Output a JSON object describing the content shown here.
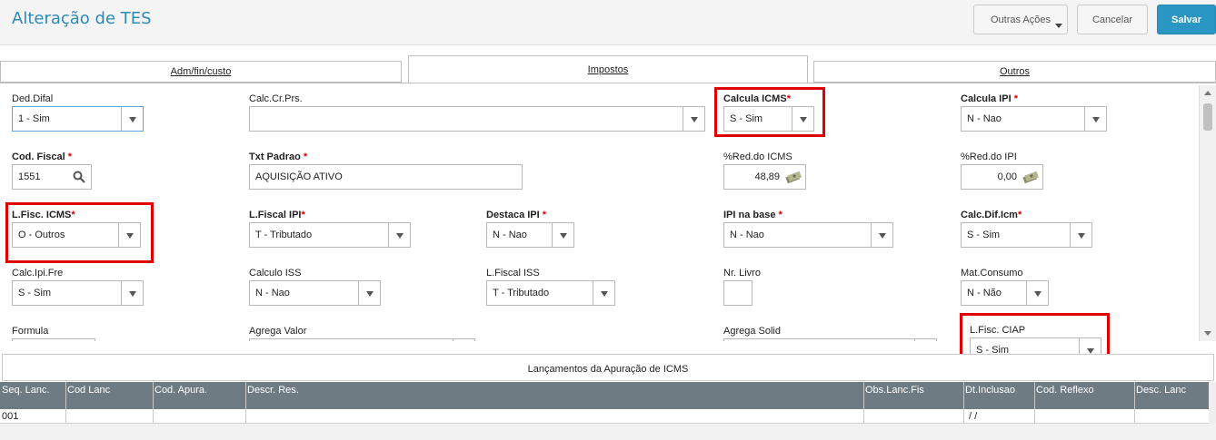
{
  "header": {
    "title": "Alteração de TES",
    "more_actions": "Outras Ações",
    "cancel": "Cancelar",
    "save": "Salvar"
  },
  "tabs": [
    {
      "label": "Adm/fin/custo",
      "active": false
    },
    {
      "label": "Impostos",
      "active": true
    },
    {
      "label": "Outros",
      "active": false
    }
  ],
  "form": {
    "ded_difal": {
      "label": "Ded.Difal",
      "value": "1 - Sim"
    },
    "calc_cr_prs": {
      "label": "Calc.Cr.Prs.",
      "value": ""
    },
    "calcula_icms": {
      "label": "Calcula ICMS",
      "value": "S - Sim",
      "required": "*"
    },
    "calcula_ipi": {
      "label": "Calcula IPI",
      "value": "N - Nao",
      "required": "*"
    },
    "cod_fiscal": {
      "label": "Cod. Fiscal",
      "value": "1551",
      "required": "*"
    },
    "txt_padrao": {
      "label": "Txt Padrao",
      "value": "AQUISIÇÃO ATIVO",
      "required": "*"
    },
    "red_icms": {
      "label": "%Red.do ICMS",
      "value": "48,89"
    },
    "red_ipi": {
      "label": "%Red.do IPI",
      "value": "0,00"
    },
    "lfisc_icms": {
      "label": "L.Fisc. ICMS",
      "value": "O - Outros",
      "required": "*"
    },
    "lfiscal_ipi": {
      "label": "L.Fiscal IPI",
      "value": "T - Tributado",
      "required": "*"
    },
    "destaca_ipi": {
      "label": "Destaca IPI",
      "value": "N - Nao",
      "required": "*"
    },
    "ipi_na_base": {
      "label": "IPI na base",
      "value": "N - Nao",
      "required": "*"
    },
    "calc_dif_icm": {
      "label": "Calc.Dif.Icm",
      "value": "S - Sim",
      "required": "*"
    },
    "calc_ipi_fre": {
      "label": "Calc.Ipi.Fre",
      "value": "S - Sim"
    },
    "calculo_iss": {
      "label": "Calculo ISS",
      "value": "N - Nao"
    },
    "lfiscal_iss": {
      "label": "L.Fiscal ISS",
      "value": "T - Tributado"
    },
    "nr_livro": {
      "label": "Nr. Livro",
      "value": ""
    },
    "mat_consumo": {
      "label": "Mat.Consumo",
      "value": "N - Não"
    },
    "formula": {
      "label": "Formula"
    },
    "agrega_valor": {
      "label": "Agrega Valor"
    },
    "agrega_solid": {
      "label": "Agrega Solid"
    },
    "lfisc_ciap": {
      "label": "L.Fisc. CIAP",
      "value": "S - Sim"
    }
  },
  "grid": {
    "title": "Lançamentos da Apuração de ICMS",
    "columns": [
      "Seq. Lanc.",
      "Cod Lanc",
      "Cod. Apura.",
      "Descr. Res.",
      "Obs.Lanc.Fis",
      "Dt.Inclusao",
      "Cod. Reflexo",
      "Desc. Lanc"
    ],
    "row": [
      "001",
      "",
      "",
      "",
      "",
      "/ /",
      "",
      ""
    ]
  },
  "colors": {
    "accent": "#2996c4",
    "highlight": "#e00000",
    "grid_header": "#6f7b83"
  }
}
